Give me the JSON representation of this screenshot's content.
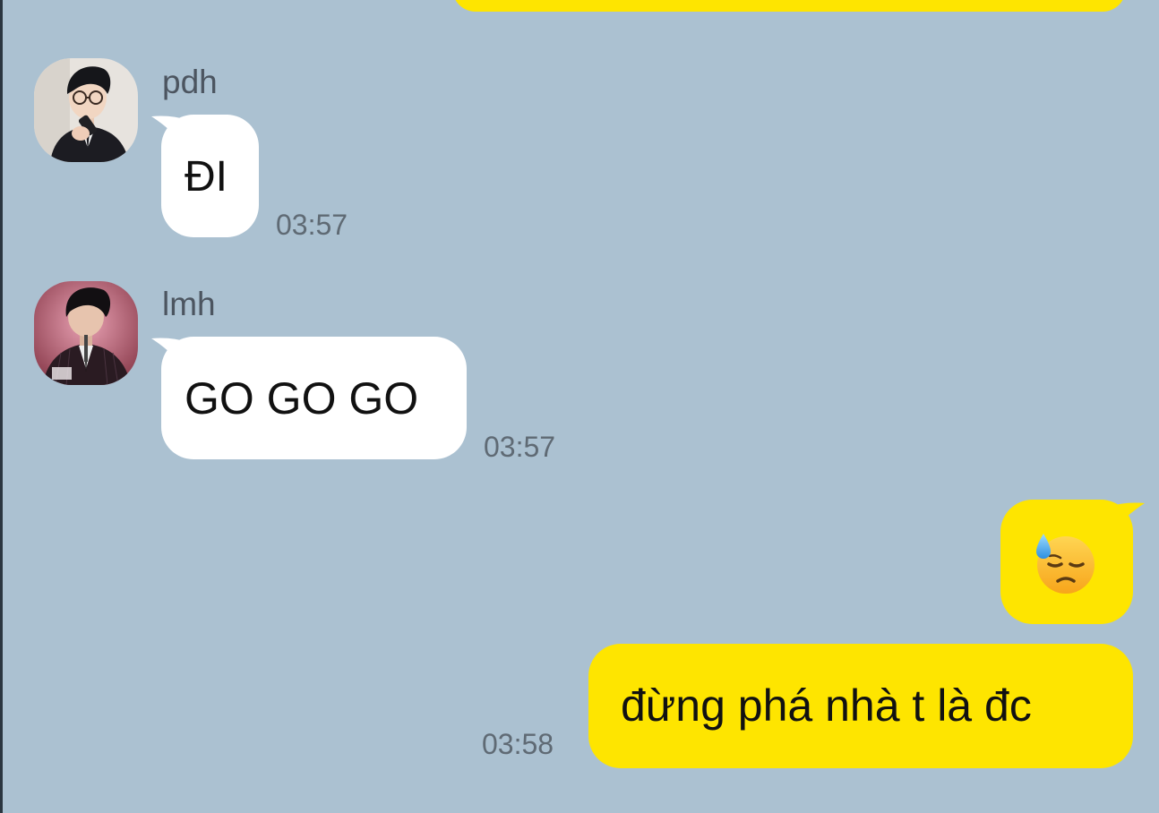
{
  "colors": {
    "background": "#abc1d1",
    "incoming_bubble": "#ffffff",
    "outgoing_bubble": "#fee500",
    "sender_name": "#4c5560",
    "timestamp": "#5f6a74"
  },
  "messages": [
    {
      "id": "msg-1",
      "direction": "incoming",
      "sender": "pdh",
      "avatar": "avatar-pdh",
      "text": "ĐI",
      "time": "03:57"
    },
    {
      "id": "msg-2",
      "direction": "incoming",
      "sender": "lmh",
      "avatar": "avatar-lmh",
      "text": "GO GO GO",
      "time": "03:57"
    },
    {
      "id": "msg-3",
      "direction": "outgoing",
      "emoji": "downcast-face-with-sweat-emoji",
      "text": ""
    },
    {
      "id": "msg-4",
      "direction": "outgoing",
      "text": "đừng phá nhà t là đc",
      "time": "03:58"
    }
  ]
}
